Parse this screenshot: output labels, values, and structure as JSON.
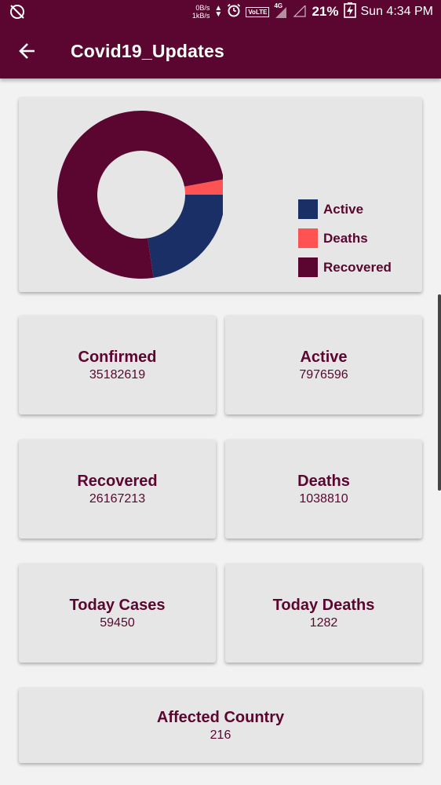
{
  "status_bar": {
    "net_up": "0B/s",
    "net_down": "1kB/s",
    "volte": "VoLTE",
    "network": "4G",
    "battery": "21%",
    "clock": "Sun 4:34 PM",
    "icons": [
      "sync-off-icon",
      "alarm-icon",
      "signal-icon",
      "battery-charging-icon"
    ]
  },
  "app_bar": {
    "title": "Covid19_Updates",
    "back_icon": "arrow-back-icon"
  },
  "colors": {
    "primary": "#5a0630",
    "active": "#1a2f66",
    "deaths": "#ff5252",
    "recovered": "#5a0630",
    "card": "#e6e6e6"
  },
  "chart_data": {
    "type": "pie",
    "donut": true,
    "title": "",
    "categories": [
      "Active",
      "Deaths",
      "Recovered"
    ],
    "values": [
      7976596,
      1038810,
      26167213
    ],
    "colors": [
      "#1a2f66",
      "#ff5252",
      "#5a0630"
    ],
    "legend_position": "right"
  },
  "stats": {
    "confirmed": {
      "label": "Confirmed",
      "value": "35182619"
    },
    "active": {
      "label": "Active",
      "value": "7976596"
    },
    "recovered": {
      "label": "Recovered",
      "value": "26167213"
    },
    "deaths": {
      "label": "Deaths",
      "value": "1038810"
    },
    "today_cases": {
      "label": "Today Cases",
      "value": "59450"
    },
    "today_deaths": {
      "label": "Today Deaths",
      "value": "1282"
    },
    "affected_country": {
      "label": "Affected Country",
      "value": "216"
    }
  }
}
